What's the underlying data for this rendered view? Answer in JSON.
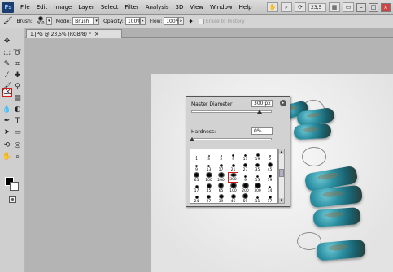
{
  "menu": {
    "logo": "Ps",
    "items": [
      "File",
      "Edit",
      "Image",
      "Layer",
      "Select",
      "Filter",
      "Analysis",
      "3D",
      "View",
      "Window",
      "Help"
    ],
    "zoom": "23,5"
  },
  "options": {
    "brush_label": "Brush:",
    "brush_size": "300",
    "mode_label": "Mode:",
    "mode_value": "Brush",
    "opacity_label": "Opacity:",
    "opacity_value": "100%",
    "flow_label": "Flow:",
    "flow_value": "100%",
    "history_label": "Erase to History"
  },
  "document": {
    "tab_title": "1.JPG @ 23,5% (RGB/8) *",
    "close": "×"
  },
  "brush_picker": {
    "diameter_label": "Master Diameter",
    "diameter_value": "300 px",
    "diameter_level": 0.86,
    "hardness_label": "Hardness:",
    "hardness_value": "0%",
    "hardness_level": 0.0,
    "presets": [
      [
        "1",
        "3",
        "5",
        "9",
        "13",
        "19",
        "5"
      ],
      [
        "9",
        "13",
        "17",
        "21",
        "27",
        "35",
        "45"
      ],
      [
        "65",
        "100",
        "200",
        "300",
        "9",
        "13",
        "19"
      ],
      [
        "17",
        "45",
        "65",
        "100",
        "200",
        "300",
        "14"
      ],
      [
        "24",
        "27",
        "39",
        "46",
        "59",
        "11",
        "17"
      ],
      [
        "23",
        "36",
        "44",
        "60",
        "14",
        "26",
        "33"
      ],
      [
        "42",
        "55",
        "70",
        "112",
        "134",
        "74",
        "95"
      ],
      [
        "29",
        "192",
        "36",
        "36",
        "33",
        "63",
        "66"
      ],
      [
        "39",
        "63",
        "11",
        "48",
        "32",
        "55",
        "100"
      ],
      [
        "75",
        "45",
        "1106",
        "1499",
        "1569",
        "1875",
        "1953"
      ],
      [
        "65",
        "100",
        "200",
        "300",
        "500",
        "197",
        "20"
      ]
    ],
    "selected": "300"
  }
}
